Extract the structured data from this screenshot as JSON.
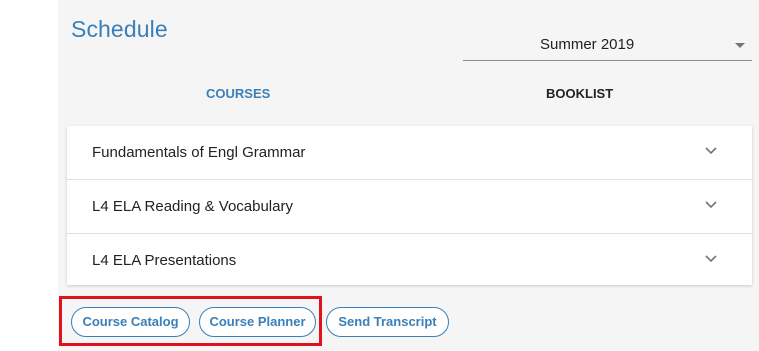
{
  "header": {
    "title": "Schedule"
  },
  "term_select": {
    "value": "Summer 2019",
    "caret_icon": "caret-down-icon"
  },
  "tabs": [
    {
      "label": "COURSES",
      "active": true
    },
    {
      "label": "BOOKLIST",
      "active": false
    }
  ],
  "courses": [
    {
      "name": "Fundamentals of Engl Grammar",
      "icon": "chevron-down-icon"
    },
    {
      "name": "L4 ELA Reading & Vocabulary",
      "icon": "chevron-down-icon"
    },
    {
      "name": "L4 ELA Presentations",
      "icon": "chevron-down-icon"
    }
  ],
  "actions": {
    "catalog_label": "Course Catalog",
    "planner_label": "Course Planner",
    "transcript_label": "Send Transcript"
  },
  "colors": {
    "accent": "#3a7fb8",
    "highlight": "#e0121e",
    "panel_bg": "#f5f5f5"
  }
}
